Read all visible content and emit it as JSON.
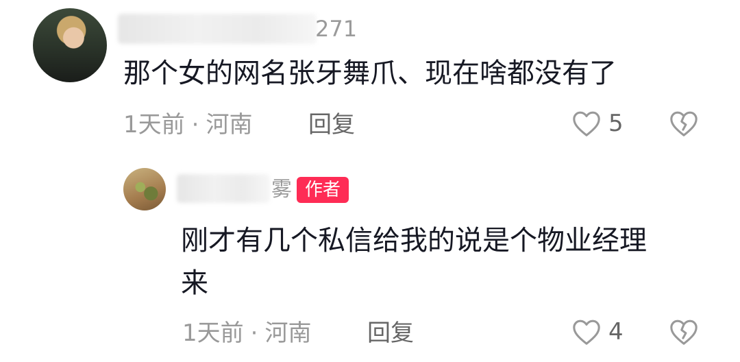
{
  "comments": [
    {
      "username_suffix": "271",
      "text": "那个女的网名张牙舞爪、现在啥都没有了",
      "time": "1天前",
      "separator": "·",
      "location": "河南",
      "reply_label": "回复",
      "likes": "5",
      "icons": {
        "like": "heart-outline-icon",
        "dislike": "broken-heart-icon"
      }
    }
  ],
  "replies": [
    {
      "username_suffix": "雾",
      "badge": "作者",
      "text": "刚才有几个私信给我的说是个物业经理\n来",
      "time": "1天前",
      "separator": "·",
      "location": "河南",
      "reply_label": "回复",
      "likes": "4",
      "icons": {
        "like": "heart-outline-icon",
        "dislike": "broken-heart-icon"
      }
    }
  ],
  "colors": {
    "badge_background": "#fe2c55",
    "text_primary": "#161823",
    "text_secondary": "#999999"
  }
}
